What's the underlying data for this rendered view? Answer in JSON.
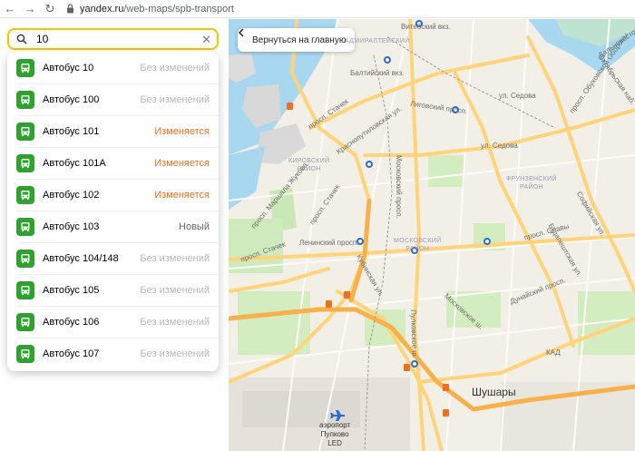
{
  "browser": {
    "url_domain": "yandex.ru",
    "url_path": "/web-maps/spb-transport"
  },
  "search": {
    "value": "10"
  },
  "routes": [
    {
      "name": "Автобус 10",
      "status": "Без изменений",
      "kind": "none"
    },
    {
      "name": "Автобус 100",
      "status": "Без изменений",
      "kind": "none"
    },
    {
      "name": "Автобус 101",
      "status": "Изменяется",
      "kind": "change"
    },
    {
      "name": "Автобус 101А",
      "status": "Изменяется",
      "kind": "change"
    },
    {
      "name": "Автобус 102",
      "status": "Изменяется",
      "kind": "change"
    },
    {
      "name": "Автобус 103",
      "status": "Новый",
      "kind": "new"
    },
    {
      "name": "Автобус 104/148",
      "status": "Без изменений",
      "kind": "none"
    },
    {
      "name": "Автобус 105",
      "status": "Без изменений",
      "kind": "none"
    },
    {
      "name": "Автобус 106",
      "status": "Без изменений",
      "kind": "none"
    },
    {
      "name": "Автобус 107",
      "status": "Без изменений",
      "kind": "none"
    }
  ],
  "colors": {
    "bus_green": "#2ea12f",
    "status_change": "#f06f25",
    "status_none": "#b8b8b8",
    "search_border": "#f5c400"
  },
  "map": {
    "back_button_label": "Вернуться на главную",
    "districts": {
      "admiralteysky": "АДМИРАЛТЕЙСКИЙ",
      "kirovsky": "КИРОВСКИЙ\nРАЙОН",
      "frunzensky": "ФРУНЗЕНСКИЙ\nРАЙОН",
      "moskovsky": "МОСКОВСКИЙ\nРАЙОН"
    },
    "labels": {
      "vitebsky": "Витебский вкз.",
      "baltiysky": "Балтийский вкз.",
      "ligovsky": "Лиговский просп.",
      "sedova": "ул. Седова",
      "stachek1": "просп. Стачек",
      "stachek2": "просп. Стачек",
      "stachek3": "просп. Стачек",
      "leninsky": "Ленинский просп.",
      "moskovsky_pr": "Московский просп.",
      "moskovskoe": "Московское ш.",
      "pulkovskoe": "Пулковское ш.",
      "slavy": "просп. Славы",
      "obukhovskoy": "просп. Обуховской Обороны",
      "oktyabrskaya": "Октябрьская наб.",
      "dalnevostochny": "Дальневосточный просп.",
      "sofiyskaya": "Софийская ул.",
      "kubinskaya": "Кубинская ул.",
      "dunaysky": "Дунайский просп.",
      "budapeshtskaya": "Будапештская ул.",
      "kad": "КАД",
      "marshala_zhukova": "просп. Маршала Жукова",
      "krasnoputilovskaya": "Краснопутиловская ул."
    },
    "city": "Шушары",
    "airport": "аэропорт\nПулково\nLED"
  }
}
